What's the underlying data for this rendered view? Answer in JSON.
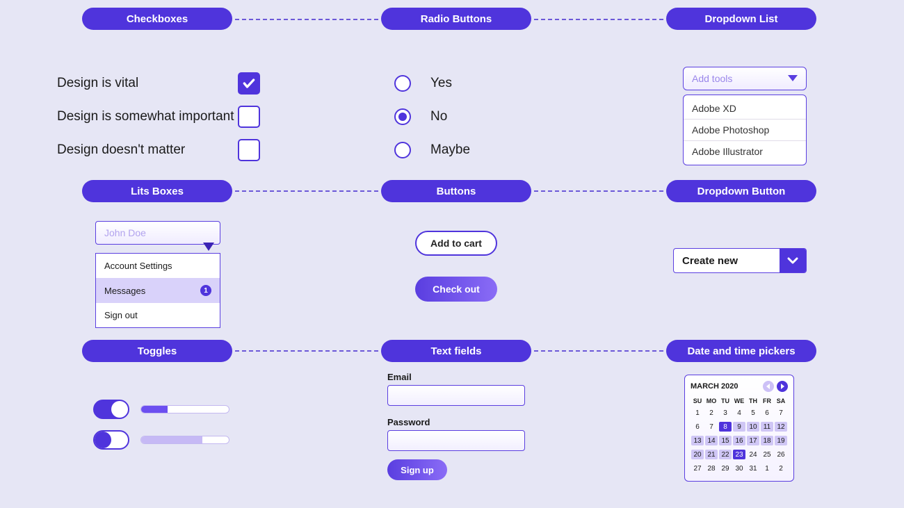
{
  "sections": {
    "checkboxes": "Checkboxes",
    "radio": "Radio Buttons",
    "dropdownList": "Dropdown List",
    "listBoxes": "Lits Boxes",
    "buttons": "Buttons",
    "dropdownButton": "Dropdown Button",
    "toggles": "Toggles",
    "textFields": "Text fields",
    "dateTime": "Date and time pickers"
  },
  "checkboxes": [
    {
      "label": "Design is vital",
      "checked": true
    },
    {
      "label": "Design is somewhat important",
      "checked": false
    },
    {
      "label": "Design doesn't matter",
      "checked": false
    }
  ],
  "radios": [
    {
      "label": "Yes",
      "selected": false
    },
    {
      "label": "No",
      "selected": true
    },
    {
      "label": "Maybe",
      "selected": false
    }
  ],
  "dropdownList": {
    "placeholder": "Add tools",
    "items": [
      "Adobe XD",
      "Adobe Photoshop",
      "Adobe Illustrator"
    ]
  },
  "listBox": {
    "placeholder": "John Doe",
    "items": [
      {
        "label": "Account Settings",
        "selected": false,
        "badge": null
      },
      {
        "label": "Messages",
        "selected": true,
        "badge": "1"
      },
      {
        "label": "Sign out",
        "selected": false,
        "badge": null
      }
    ]
  },
  "buttons": {
    "outline": "Add to cart",
    "fill": "Check out"
  },
  "dropdownButton": {
    "label": "Create new"
  },
  "toggles": {
    "progressA": 30,
    "progressB": 70
  },
  "textFields": {
    "emailLabel": "Email",
    "passwordLabel": "Password",
    "submit": "Sign up"
  },
  "calendar": {
    "title": "MARCH 2020",
    "dow": [
      "SU",
      "MO",
      "TU",
      "WE",
      "TH",
      "FR",
      "SA"
    ],
    "weeks": [
      [
        {
          "n": "1"
        },
        {
          "n": "2"
        },
        {
          "n": "3"
        },
        {
          "n": "4"
        },
        {
          "n": "5"
        },
        {
          "n": "6"
        },
        {
          "n": "7"
        }
      ],
      [
        {
          "n": "6"
        },
        {
          "n": "7"
        },
        {
          "n": "8",
          "sel": true
        },
        {
          "n": "9",
          "hl": true
        },
        {
          "n": "10",
          "hl": true
        },
        {
          "n": "11",
          "hl": true
        },
        {
          "n": "12",
          "hl": true
        }
      ],
      [
        {
          "n": "13",
          "hl": true
        },
        {
          "n": "14",
          "hl": true
        },
        {
          "n": "15",
          "hl": true
        },
        {
          "n": "16",
          "hl": true
        },
        {
          "n": "17",
          "hl": true
        },
        {
          "n": "18",
          "hl": true
        },
        {
          "n": "19",
          "hl": true
        }
      ],
      [
        {
          "n": "20",
          "hl": true
        },
        {
          "n": "21",
          "hl": true
        },
        {
          "n": "22",
          "hl": true
        },
        {
          "n": "23",
          "sel": true
        },
        {
          "n": "24"
        },
        {
          "n": "25"
        },
        {
          "n": "26"
        }
      ],
      [
        {
          "n": "27"
        },
        {
          "n": "28"
        },
        {
          "n": "29"
        },
        {
          "n": "30"
        },
        {
          "n": "31"
        },
        {
          "n": "1"
        },
        {
          "n": "2"
        }
      ]
    ]
  }
}
